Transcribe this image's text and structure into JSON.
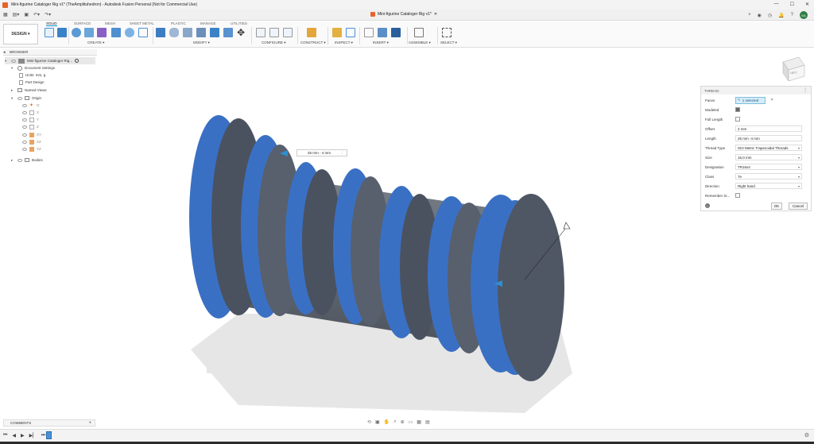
{
  "window": {
    "title": "Mini-figurine Cataloger Rig v1* (TheAmplituhedron) - Autodesk Fusion Personal (Not for Commercial Use)",
    "controls": [
      "—",
      "☐",
      "✕"
    ]
  },
  "doc_tab": {
    "label": "Mini-figurine Cataloger Rig v1*",
    "close": "✕"
  },
  "account": {
    "initials": "KA"
  },
  "workspace": {
    "label": "DESIGN ▾"
  },
  "ribbon_tabs": [
    "SOLID",
    "SURFACE",
    "MESH",
    "SHEET METAL",
    "PLASTIC",
    "MANAGE",
    "UTILITIES"
  ],
  "ribbon_groups": [
    "CREATE ▾",
    "MODIFY ▾",
    "CONFIGURE ▾",
    "CONSTRUCT ▾",
    "INSPECT ▾",
    "INSERT ▾",
    "ASSEMBLE ▾",
    "SELECT ▾"
  ],
  "browser": {
    "title": "BROWSER",
    "items": [
      {
        "label": "Mini-figurine Cataloger Rig..."
      },
      {
        "label": "Document Settings"
      },
      {
        "label": "Units: mm, g"
      },
      {
        "label": "Part Design"
      },
      {
        "label": "Named Views"
      },
      {
        "label": "Origin"
      },
      {
        "label": "O"
      },
      {
        "label": "X"
      },
      {
        "label": "Y"
      },
      {
        "label": "Z"
      },
      {
        "label": "XY"
      },
      {
        "label": "XZ"
      },
      {
        "label": "YZ"
      },
      {
        "label": "Bodies"
      }
    ]
  },
  "viewcube": {
    "face_label": "LEFT"
  },
  "length_tooltip": {
    "value": "25 mm - 4 mm"
  },
  "thread_dialog": {
    "title": "THREAD",
    "faces": {
      "label": "Faces",
      "value": "1 selected",
      "clear": "✕"
    },
    "modeled": {
      "label": "Modeled",
      "checked": true
    },
    "full_length": {
      "label": "Full Length",
      "checked": false
    },
    "offset": {
      "label": "Offset",
      "value": "2 mm"
    },
    "length": {
      "label": "Length",
      "value": "25 mm -4 mm"
    },
    "thread_type": {
      "label": "Thread Type",
      "value": "ISO Metric Trapezoidal Threads"
    },
    "size": {
      "label": "Size",
      "value": "16.0 mm"
    },
    "designation": {
      "label": "Designation",
      "value": "TR16x4"
    },
    "class": {
      "label": "Class",
      "value": "7e"
    },
    "direction": {
      "label": "Direction",
      "value": "Right hand"
    },
    "remember": {
      "label": "Remember Si...",
      "checked": false
    },
    "ok": "OK",
    "cancel": "Cancel"
  },
  "comments": {
    "title": "COMMENTS",
    "add": "+"
  },
  "colors": {
    "thread_blue": "#3a70c4",
    "body_gray": "#5c6470",
    "accent": "#0696d7"
  }
}
